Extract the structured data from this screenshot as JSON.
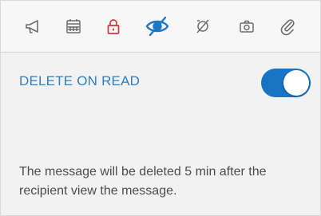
{
  "toolbar": {
    "icons": [
      {
        "name": "megaphone-icon",
        "color": "#6d6d6d"
      },
      {
        "name": "calendar-icon",
        "color": "#6d6d6d"
      },
      {
        "name": "lock-icon",
        "color": "#e0323a"
      },
      {
        "name": "eye-slash-icon",
        "color": "#1e78c8",
        "active": true
      },
      {
        "name": "no-image-icon",
        "color": "#6d6d6d"
      },
      {
        "name": "camera-icon",
        "color": "#6d6d6d"
      },
      {
        "name": "paperclip-icon",
        "color": "#6d6d6d"
      }
    ]
  },
  "option": {
    "label": "DELETE ON READ",
    "enabled": true,
    "toggle_color": "#1a74c5",
    "label_color": "#2e7fbf"
  },
  "description": "The message will be deleted 5 min after the recipient view the message."
}
